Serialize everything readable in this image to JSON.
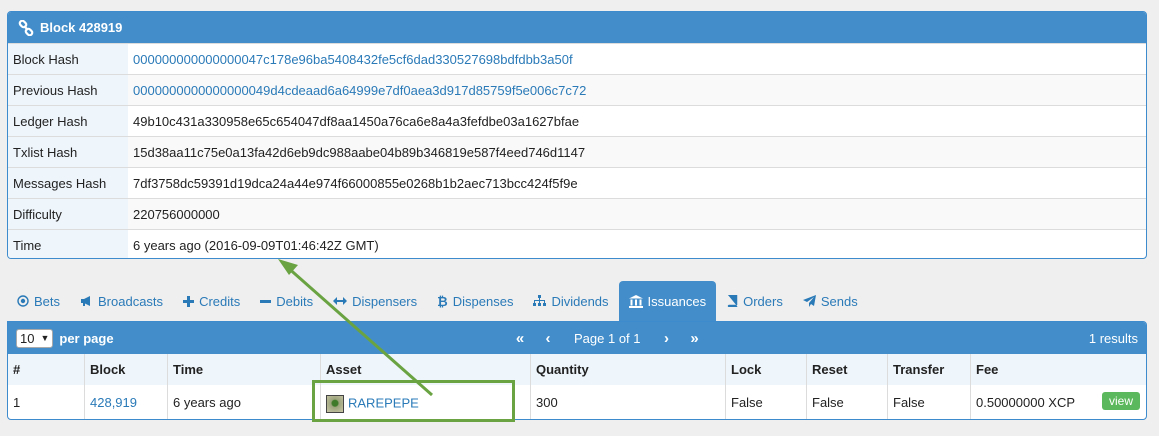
{
  "block_panel": {
    "title": "Block 428919",
    "rows": [
      {
        "label": "Block Hash",
        "value": "000000000000000047c178e96ba5408432fe5cf6dad330527698bdfdbb3a50f",
        "link": true
      },
      {
        "label": "Previous Hash",
        "value": "0000000000000000049d4cdeaad6a64999e7df0aea3d917d85759f5e006c7c72",
        "link": true
      },
      {
        "label": "Ledger Hash",
        "value": "49b10c431a330958e65c654047df8aa1450a76ca6e8a4a3fefdbe03a1627bfae",
        "link": false
      },
      {
        "label": "Txlist Hash",
        "value": "15d38aa11c75e0a13fa42d6eb9dc988aabe04b89b346819e587f4eed746d1147",
        "link": false
      },
      {
        "label": "Messages Hash",
        "value": "7df3758dc59391d19dca24a44e974f66000855e0268b1b2aec713bcc424f5f9e",
        "link": false
      },
      {
        "label": "Difficulty",
        "value": "220756000000",
        "link": false
      },
      {
        "label": "Time",
        "value": "6 years ago (2016-09-09T01:46:42Z GMT)",
        "link": false
      }
    ]
  },
  "tabs": [
    {
      "label": "Bets",
      "icon": "target-icon"
    },
    {
      "label": "Broadcasts",
      "icon": "megaphone-icon"
    },
    {
      "label": "Credits",
      "icon": "plus-icon"
    },
    {
      "label": "Debits",
      "icon": "minus-icon"
    },
    {
      "label": "Dispensers",
      "icon": "arrows-horizontal-icon"
    },
    {
      "label": "Dispenses",
      "icon": "bitcoin-icon"
    },
    {
      "label": "Dividends",
      "icon": "sitemap-icon"
    },
    {
      "label": "Issuances",
      "icon": "bank-icon",
      "active": true
    },
    {
      "label": "Orders",
      "icon": "book-icon"
    },
    {
      "label": "Sends",
      "icon": "paper-plane-icon"
    }
  ],
  "issuances": {
    "per_page_value": "10",
    "per_page_label": "per page",
    "pager_first": "«",
    "pager_prev": "‹",
    "page_label": "Page 1 of 1",
    "pager_next": "›",
    "pager_last": "»",
    "results": "1 results",
    "columns": [
      "#",
      "Block",
      "Time",
      "Asset",
      "Quantity",
      "Lock",
      "Reset",
      "Transfer",
      "Fee"
    ],
    "row": {
      "index": "1",
      "block": "428,919",
      "time": "6 years ago",
      "asset": "RAREPEPE",
      "quantity": "300",
      "lock": "False",
      "reset": "False",
      "transfer": "False",
      "fee": "0.50000000 XCP",
      "view_label": "view"
    }
  },
  "colors": {
    "accent": "#438eca",
    "link": "#2a7ab8",
    "annotation": "#6aa342",
    "view_button": "#5cb85c"
  }
}
